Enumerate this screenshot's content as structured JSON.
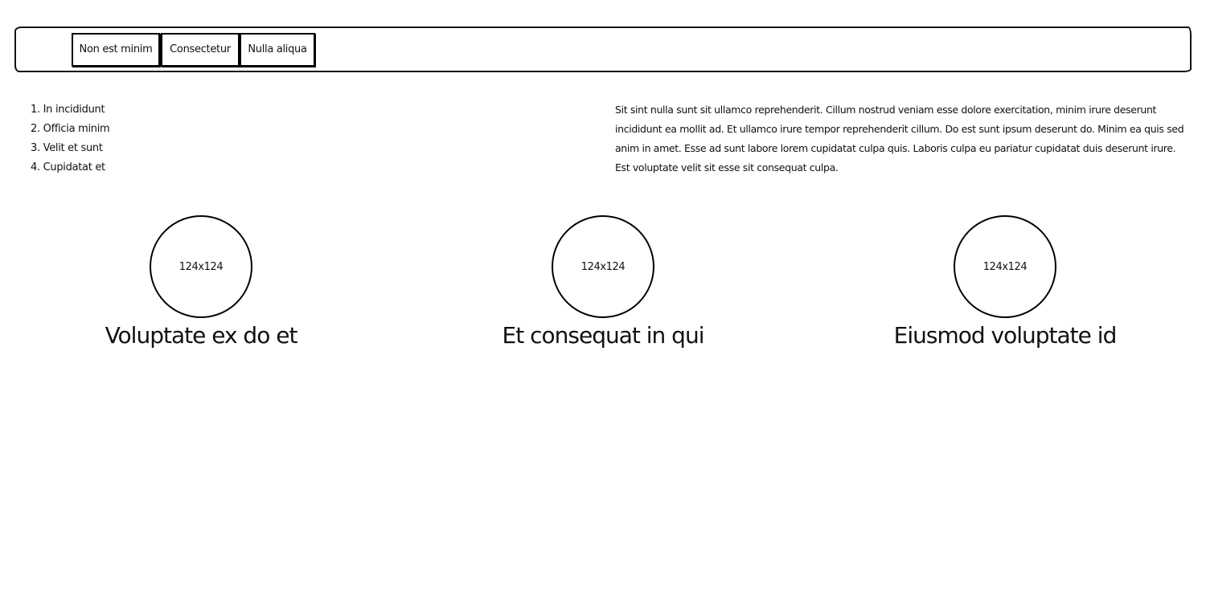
{
  "nav": {
    "tabs": [
      {
        "label": "Non est minim"
      },
      {
        "label": "Consectetur"
      },
      {
        "label": "Nulla aliqua"
      }
    ]
  },
  "list": {
    "items": [
      "1. In incididunt",
      "2. Officia minim",
      "3. Velit et sunt",
      "4. Cupidatat et"
    ]
  },
  "paragraph": {
    "text": "Sit sint nulla sunt sit ullamco reprehenderit. Cillum nostrud veniam esse dolore exercitation, minim irure deserunt incididunt ea mollit ad. Et ullamco irure tempor reprehenderit cillum. Do est sunt ipsum deserunt do. Minim ea quis sed anim in amet. Esse ad sunt labore lorem cupidatat culpa quis. Laboris culpa eu pariatur cupidatat duis deserunt irure. Est voluptate velit sit esse sit consequat culpa."
  },
  "features": [
    {
      "image_label": "124x124",
      "title": "Voluptate ex do et"
    },
    {
      "image_label": "124x124",
      "title": "Et consequat in qui"
    },
    {
      "image_label": "124x124",
      "title": "Eiusmod voluptate id"
    }
  ]
}
